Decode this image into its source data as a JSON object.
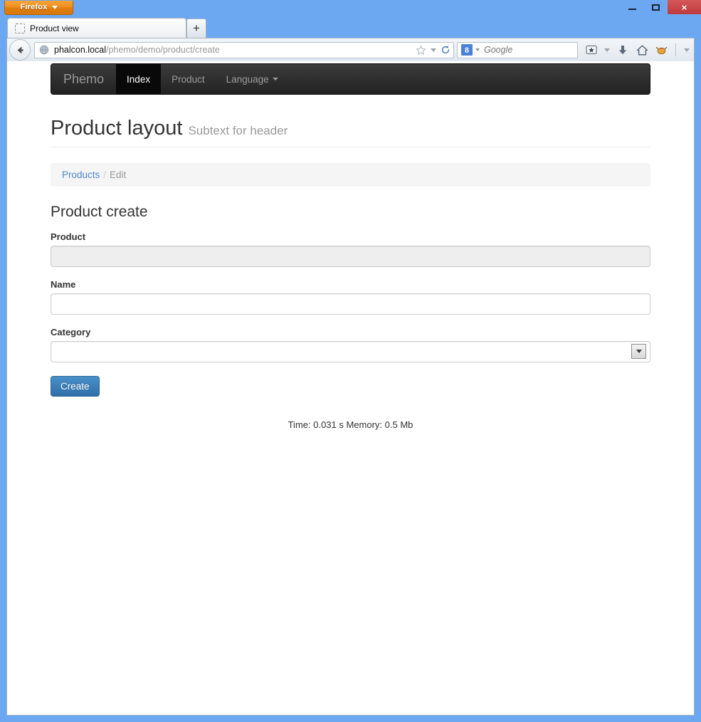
{
  "browser": {
    "app_button_label": "Firefox",
    "window_controls": {
      "minimize": "minimize-button",
      "maximize": "maximize-button",
      "close": "×"
    },
    "tab": {
      "title": "Product view",
      "new_tab_label": "+"
    },
    "address_bar": {
      "host": "phalcon.local",
      "path": "/phemo/demo/product/create"
    },
    "search_bar": {
      "engine": "Google",
      "engine_badge": "8",
      "placeholder": "Google"
    },
    "toolbar_icons": [
      "bookmarks-icon",
      "downloads-icon",
      "home-icon",
      "addon-icon",
      "overflow-caret-icon"
    ]
  },
  "site": {
    "navbar": {
      "brand": "Phemo",
      "links": [
        {
          "label": "Index",
          "active": true
        },
        {
          "label": "Product",
          "active": false
        },
        {
          "label": "Language",
          "active": false,
          "dropdown": true
        }
      ]
    },
    "page_header": {
      "title": "Product layout",
      "subtitle": "Subtext for header"
    },
    "breadcrumb": {
      "link": "Products",
      "separator": "/",
      "current": "Edit"
    },
    "form": {
      "title": "Product create",
      "fields": [
        {
          "label": "Product",
          "type": "text",
          "value": "",
          "placeholder": "",
          "disabled": true
        },
        {
          "label": "Name",
          "type": "text",
          "value": "",
          "placeholder": "",
          "disabled": false
        },
        {
          "label": "Category",
          "type": "select",
          "value": "",
          "options": [
            ""
          ],
          "disabled": false
        }
      ],
      "submit_label": "Create"
    },
    "footer": {
      "stats": "Time: 0.031 s Memory: 0.5 Mb"
    }
  },
  "colors": {
    "accent": "#2f6fa8",
    "link": "#4d87cb",
    "navbar_bg": "#222222",
    "chrome_blue": "#6ca8f2",
    "firefox_orange": "#e07d0c",
    "close_red": "#c9484a"
  }
}
